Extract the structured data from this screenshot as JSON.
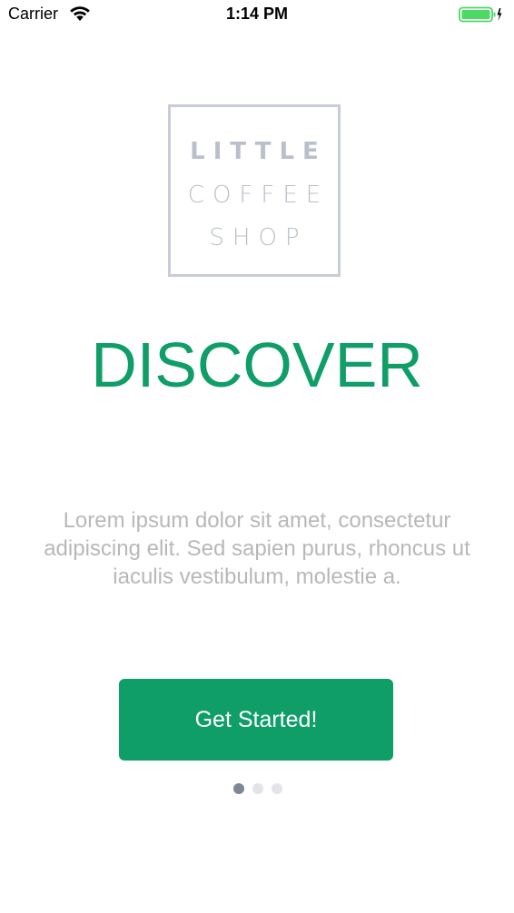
{
  "status_bar": {
    "carrier": "Carrier",
    "time": "1:14 PM",
    "battery_color": "#4cd964"
  },
  "logo": {
    "line1": "LITTLE",
    "line2": "COFFEE",
    "line3": "SHOP",
    "border_color": "#c7ccd6",
    "text_color": "#b9bfcb"
  },
  "onboarding": {
    "title": "DISCOVER",
    "description": "Lorem ipsum dolor sit amet, consectetur adipiscing elit. Sed sapien purus, rhoncus ut iaculis vestibulum, molestie a.",
    "cta_label": "Get Started!",
    "accent_color": "#0f9e68",
    "page_count": 3,
    "current_page": 1
  }
}
